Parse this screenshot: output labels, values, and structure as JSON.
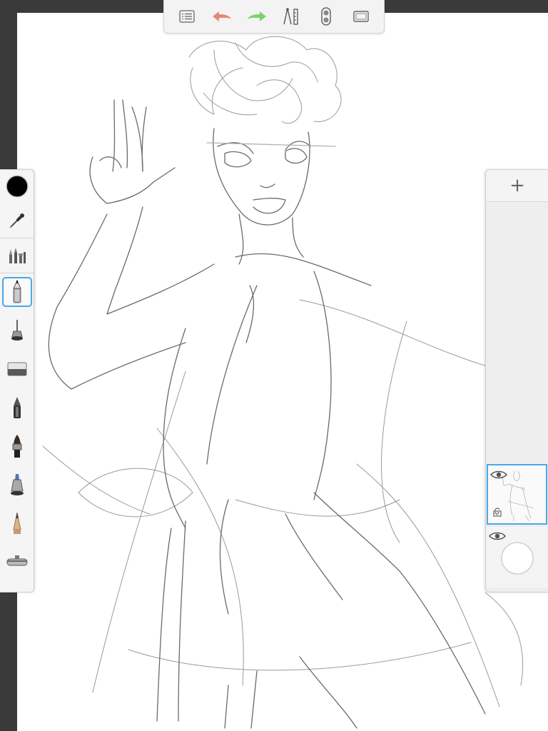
{
  "app": {
    "accent_color": "#4aa8e8",
    "canvas_color": "#ffffff",
    "background_color": "#3a3a3a"
  },
  "top_toolbar": {
    "items": [
      {
        "id": "list",
        "icon": "list-icon"
      },
      {
        "id": "undo",
        "icon": "undo-arrow-icon",
        "color": "#e8847a"
      },
      {
        "id": "redo",
        "icon": "redo-arrow-icon",
        "color": "#7ad36a"
      },
      {
        "id": "guides",
        "icon": "ruler-compass-icon"
      },
      {
        "id": "symmetry",
        "icon": "symmetry-icon"
      },
      {
        "id": "fullscreen",
        "icon": "fullscreen-icon"
      }
    ]
  },
  "left_palette": {
    "current_color": "#000000",
    "tools": [
      {
        "id": "color",
        "icon": "color-swatch-icon"
      },
      {
        "id": "eyedropper",
        "icon": "eyedropper-icon"
      },
      {
        "id": "brush-library",
        "icon": "brush-library-icon"
      },
      {
        "id": "pencil",
        "icon": "pencil-icon",
        "selected": true
      },
      {
        "id": "airbrush",
        "icon": "airbrush-icon"
      },
      {
        "id": "eraser",
        "icon": "eraser-icon"
      },
      {
        "id": "ballpoint",
        "icon": "ballpoint-pen-icon"
      },
      {
        "id": "paintbrush",
        "icon": "paintbrush-icon"
      },
      {
        "id": "marker",
        "icon": "marker-icon"
      },
      {
        "id": "crayon",
        "icon": "crayon-icon"
      },
      {
        "id": "smudge",
        "icon": "smudge-tool-icon"
      }
    ]
  },
  "layer_panel": {
    "add_label": "+",
    "layers": [
      {
        "id": "sketch-layer",
        "active": true,
        "visible": true,
        "locked": false
      },
      {
        "id": "background-layer",
        "active": false,
        "visible": true
      }
    ]
  }
}
